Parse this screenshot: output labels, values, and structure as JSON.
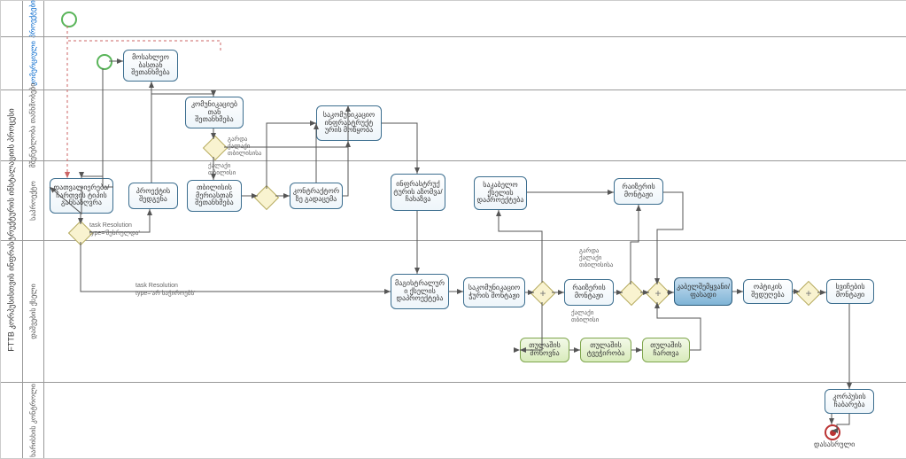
{
  "chart_data": {
    "type": "bpmn",
    "title": "FTTB კორპუსისთვის ინფრასტრუქტურის ინსტალაციის პროცესი",
    "pool": "FTTB კორპუსისთვის ინფრასტრუქტურის ინსტალაციის პროცესი",
    "lanes": [
      {
        "name": "პროექტები",
        "color": "blue"
      },
      {
        "name": "კომერციული",
        "color": "blue"
      },
      {
        "name": "მშენებლობა თანხმობები",
        "color": "default"
      },
      {
        "name": "საპროექტო",
        "color": "default"
      },
      {
        "name": "დაშვების ქსელი",
        "color": "default"
      },
      {
        "name": "ხარისხის კონტროლი",
        "color": "default"
      }
    ],
    "tasks": [
      {
        "id": "t1",
        "lane": 1,
        "label": "მოსახლეო ბასთან შეთანხმება"
      },
      {
        "id": "t2",
        "lane": 2,
        "label": "კომუნიკაციებ თან შეთანხმება"
      },
      {
        "id": "t3",
        "lane": 2,
        "label": "საკომუნიკაციო ინფრასტრუქტ ურის მოწყობა"
      },
      {
        "id": "t4",
        "lane": 3,
        "label": "დათვალიერება/ ჩართვის ტიპის განსაზღვრა"
      },
      {
        "id": "t5",
        "lane": 3,
        "label": "პროექტის შედგენა"
      },
      {
        "id": "t6",
        "lane": 3,
        "label": "თბილისის მერიასთან შეთანხმება"
      },
      {
        "id": "t7",
        "lane": 3,
        "label": "კონტრაქტორ ზე გადაცემა"
      },
      {
        "id": "t8",
        "lane": 3,
        "label": "ინფრასტრუქ ტურის აზომვა/ ჩახაზვა"
      },
      {
        "id": "t9",
        "lane": 3,
        "label": "საკაბელო ქსელის დაპროექტება"
      },
      {
        "id": "t10",
        "lane": 3,
        "label": "რაიზერის მონტაჟი",
        "group": "parallel_top"
      },
      {
        "id": "t11",
        "lane": 4,
        "label": "მაგისტრალურ ი ქსელის დაპროექტება"
      },
      {
        "id": "t12",
        "lane": 4,
        "label": "საკომუნიკაციო ჭურის მონტაჟი"
      },
      {
        "id": "t13",
        "lane": 4,
        "label": "რაიზერის მონტაჟი"
      },
      {
        "id": "t14",
        "lane": 4,
        "label": "კაბელშემყვანი/ ფასადი",
        "style": "dark"
      },
      {
        "id": "t15",
        "lane": 4,
        "label": "ოპტიკის შედუღება"
      },
      {
        "id": "t16",
        "lane": 4,
        "label": "სვიჩების მონტაჟი"
      },
      {
        "id": "t17",
        "lane": 4,
        "label": "თულაშის მოხოვნა",
        "style": "green",
        "group": "permission"
      },
      {
        "id": "t18",
        "lane": 4,
        "label": "თულაშის ტვეჭირობა",
        "style": "green",
        "group": "permission"
      },
      {
        "id": "t19",
        "lane": 4,
        "label": "თულაშის ჩართვა",
        "style": "green",
        "group": "permission"
      },
      {
        "id": "t20",
        "lane": 5,
        "label": "კორპუსის ჩაბარება"
      }
    ],
    "gateways": [
      {
        "id": "g1",
        "lane": 2,
        "type": "exclusive",
        "after": "t2",
        "labels": [
          "გარდა ქალაქი თბილისისა",
          "ქალაქი თბილისი"
        ]
      },
      {
        "id": "g2",
        "lane": 3,
        "type": "exclusive",
        "after": "t4",
        "labels": [
          "task Resolution type='შესრულდა'",
          "task Resolution type='არ საჭიროებს'"
        ]
      },
      {
        "id": "g3",
        "lane": 3,
        "type": "exclusive",
        "after": "t6"
      },
      {
        "id": "g4",
        "lane": 4,
        "type": "parallel",
        "after": "t12"
      },
      {
        "id": "g5",
        "lane": 4,
        "type": "exclusive",
        "after": "t13",
        "labels": [
          "გარდა ქალაქი თბილისისა",
          "ქალაქი თბილისი"
        ]
      },
      {
        "id": "g6",
        "lane": 4,
        "type": "parallel",
        "before": "t14"
      },
      {
        "id": "g7",
        "lane": 4,
        "type": "parallel",
        "after": "t15"
      }
    ],
    "events": [
      {
        "id": "e1",
        "lane": 0,
        "type": "start"
      },
      {
        "id": "e2",
        "lane": 1,
        "type": "start"
      },
      {
        "id": "e3",
        "lane": 5,
        "type": "end",
        "label": "დასასრული"
      }
    ],
    "flows": [
      {
        "from": "e1",
        "to": "t4",
        "type": "message"
      },
      {
        "from": "e2",
        "to": "t1"
      },
      {
        "from": "e2",
        "to": "t4"
      },
      {
        "from": "t1",
        "to": "t2"
      },
      {
        "from": "t2",
        "to": "g1"
      },
      {
        "from": "g1",
        "to": "t6",
        "label": "ქალაქი თბილისი"
      },
      {
        "from": "g1",
        "to": "t3",
        "label": "გარდა ქალაქი თბილისისა"
      },
      {
        "from": "t4",
        "to": "g2"
      },
      {
        "from": "g2",
        "to": "t5"
      },
      {
        "from": "g2",
        "to": "t11",
        "label": "task Resolution type='არ საჭიროებს'"
      },
      {
        "from": "t5",
        "to": "t1"
      },
      {
        "from": "t6",
        "to": "g3"
      },
      {
        "from": "g3",
        "to": "t7"
      },
      {
        "from": "g3",
        "to": "t3"
      },
      {
        "from": "t7",
        "to": "t3"
      },
      {
        "from": "t3",
        "to": "t8"
      },
      {
        "from": "t8",
        "to": "t11"
      },
      {
        "from": "t11",
        "to": "t12"
      },
      {
        "from": "t12",
        "to": "g4"
      },
      {
        "from": "g4",
        "to": "t9"
      },
      {
        "from": "g4",
        "to": "t13"
      },
      {
        "from": "g4",
        "to": "t17"
      },
      {
        "from": "t9",
        "to": "t10"
      },
      {
        "from": "t10",
        "to": "g6"
      },
      {
        "from": "t13",
        "to": "g5"
      },
      {
        "from": "g5",
        "to": "t14",
        "label": "ქალაქი თბილისი"
      },
      {
        "from": "g5",
        "to": "t10",
        "label": "გარდა ქალაქი თბილისისა"
      },
      {
        "from": "g6",
        "to": "t14"
      },
      {
        "from": "t17",
        "to": "t18"
      },
      {
        "from": "t18",
        "to": "t19"
      },
      {
        "from": "t19",
        "to": "g6"
      },
      {
        "from": "t14",
        "to": "t15"
      },
      {
        "from": "t15",
        "to": "g7"
      },
      {
        "from": "g7",
        "to": "t16"
      },
      {
        "from": "t16",
        "to": "t20"
      },
      {
        "from": "t20",
        "to": "e3"
      }
    ]
  },
  "end_label": "დასასრული",
  "note1a": "გარდა",
  "note1b": "ქალაქი",
  "note1c": "თბილისისა",
  "note2a": "ქალაქი",
  "note2b": "თბილისი",
  "note3a": "task Resolution",
  "note3b": "type='შესრულდა'",
  "note4a": "task Resolution",
  "note4b": "type='არ საჭიროებს'",
  "note5a": "გარდა",
  "note5b": "ქალაქი",
  "note5c": "თბილისისა",
  "note6a": "ქალაქი",
  "note6b": "თბილისი",
  "pool_title": "FTTB კორპუსისთვის  ინფრასტრუქტურის ინსტალაციის პროცესი",
  "lane0": "პროექტები",
  "lane1": "კომერციული",
  "lane2": "მშენებლობა თანხმობები",
  "lane3": "საპროექტო",
  "lane4": "დაშვების ქსელი",
  "lane5": "ხარისხის კონტროლი",
  "t1": "მოსახლეო ბასთან შეთანხმება",
  "t2": "კომუნიკაციებ თან შეთანხმება",
  "t3": "საკომუნიკაციო ინფრასტრუქტ ურის მოწყობა",
  "t4": "დათვალიერება/ ჩართვის ტიპის განსაზღვრა",
  "t5": "პროექტის შედგენა",
  "t6": "თბილისის მერიასთან შეთანხმება",
  "t7": "კონტრაქტორ ზე გადაცემა",
  "t8": "ინფრასტრუქ ტურის აზომვა/ ჩახაზვა",
  "t9": "საკაბელო ქსელის დაპროექტება",
  "t10": "რაიზერის მონტაჟი",
  "t11": "მაგისტრალურ ი ქსელის დაპროექტება",
  "t12": "საკომუნიკაციო ჭურის მონტაჟი",
  "t13": "რაიზერის მონტაჟი",
  "t14": "კაბელშემყვანი/ ფასადი",
  "t15": "ოპტიკის შედუღება",
  "t16": "სვიჩების მონტაჟი",
  "t17": "თულაშის მოხოვნა",
  "t18": "თულაშის ტვეჭირობა",
  "t19": "თულაშის ჩართვა",
  "t20": "კორპუსის ჩაბარება"
}
